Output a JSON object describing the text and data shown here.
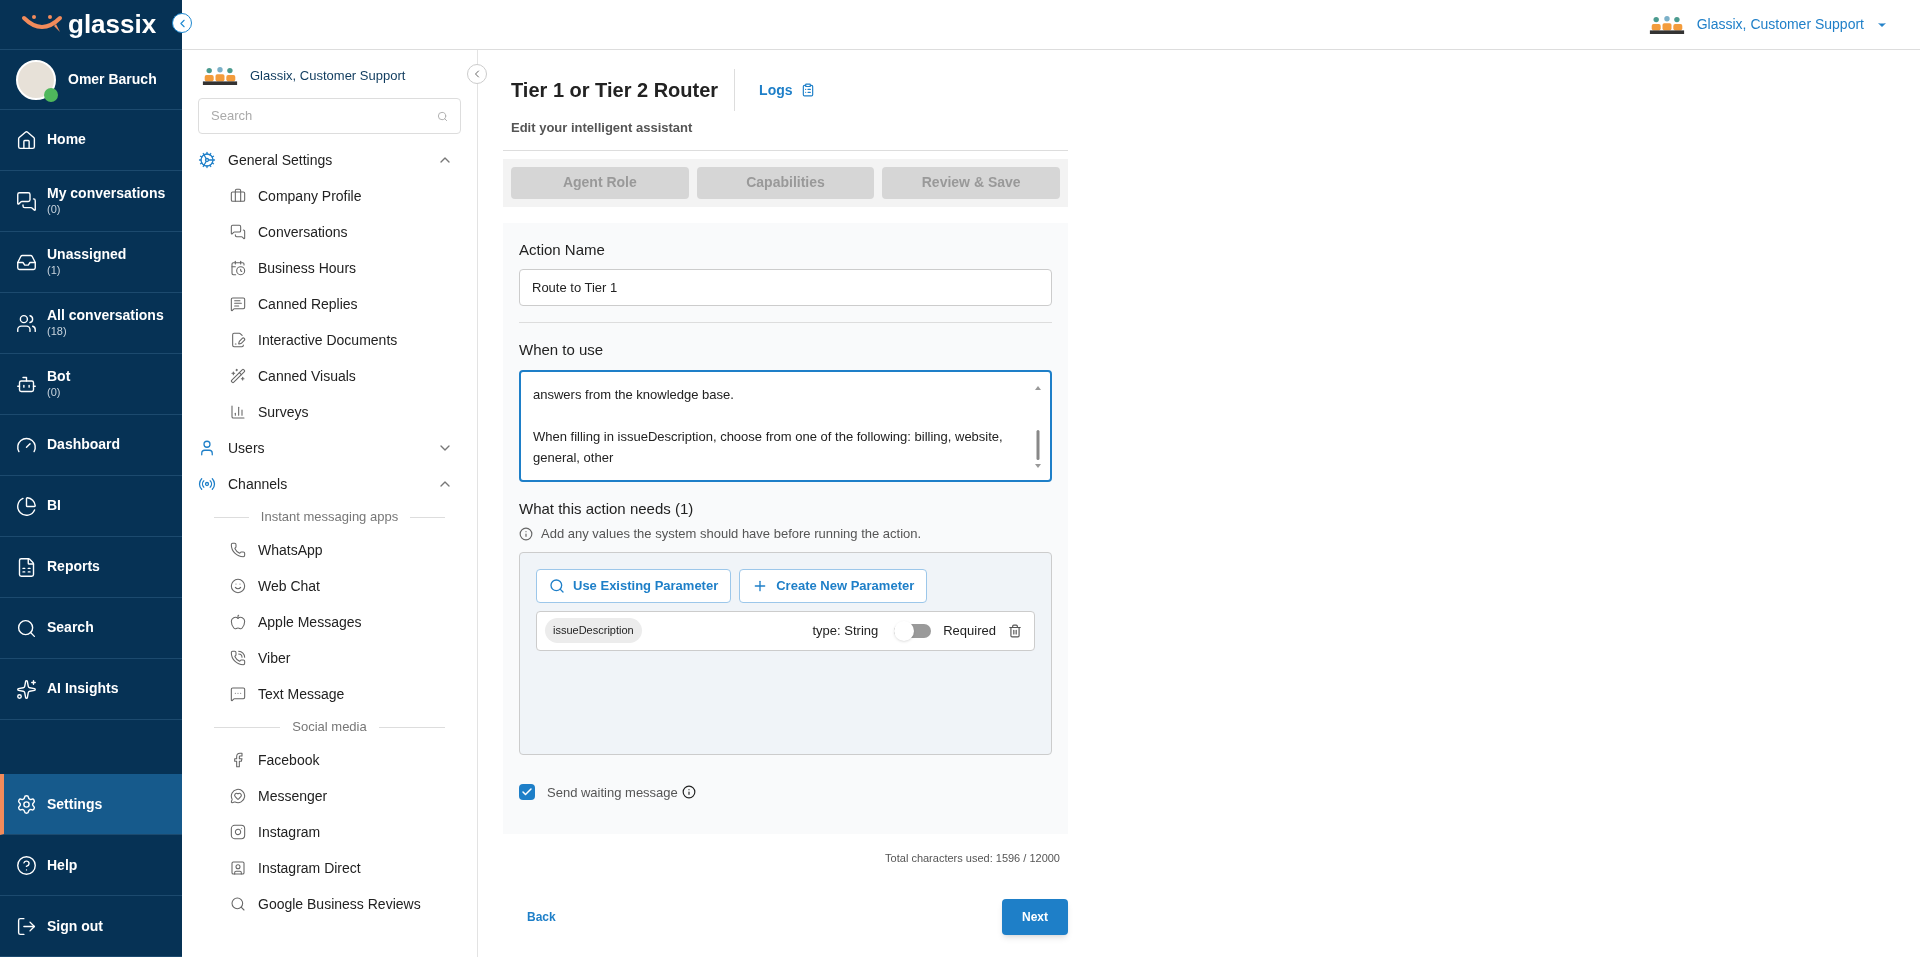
{
  "brand": {
    "name": "glassix"
  },
  "account": {
    "name": "Glassix, Customer Support"
  },
  "user": {
    "name": "Omer Baruch",
    "online": true
  },
  "nav": [
    {
      "label": "Home",
      "selected": false
    },
    {
      "label": "My conversations",
      "count": "(0)",
      "selected": false
    },
    {
      "label": "Unassigned",
      "count": "(1)",
      "selected": false
    },
    {
      "label": "All conversations",
      "count": "(18)",
      "selected": false
    },
    {
      "label": "Bot",
      "count": "(0)",
      "selected": false
    },
    {
      "label": "Dashboard",
      "selected": false
    },
    {
      "label": "BI",
      "selected": false
    },
    {
      "label": "Reports",
      "selected": false
    },
    {
      "label": "Search",
      "selected": false
    },
    {
      "label": "AI Insights",
      "selected": false
    }
  ],
  "nav_bottom": [
    {
      "label": "Settings",
      "selected": true
    },
    {
      "label": "Help",
      "selected": false
    },
    {
      "label": "Sign out",
      "selected": false
    }
  ],
  "settings_sidebar": {
    "account": "Glassix, Customer Support",
    "search_placeholder": "Search",
    "groups": [
      {
        "label": "General Settings",
        "expanded": true,
        "sections": [
          {
            "items": [
              "Company Profile",
              "Conversations",
              "Business Hours",
              "Canned Replies",
              "Interactive Documents",
              "Canned Visuals",
              "Surveys"
            ]
          }
        ]
      },
      {
        "label": "Users",
        "expanded": false
      },
      {
        "label": "Channels",
        "expanded": true,
        "sections": [
          {
            "heading": "Instant messaging apps",
            "items": [
              "WhatsApp",
              "Web Chat",
              "Apple Messages",
              "Viber",
              "Text Message"
            ]
          },
          {
            "heading": "Social media",
            "items": [
              "Facebook",
              "Messenger",
              "Instagram",
              "Instagram Direct",
              "Google Business Reviews"
            ]
          }
        ]
      }
    ]
  },
  "header": {
    "title": "Tier 1 or Tier 2 Router",
    "logs": "Logs",
    "subtitle": "Edit your intelligent assistant"
  },
  "steps": [
    {
      "label": "Agent Role",
      "disabled": true
    },
    {
      "label": "Capabilities",
      "disabled": true
    },
    {
      "label": "Review & Save",
      "disabled": true
    }
  ],
  "form": {
    "action_name_label": "Action Name",
    "action_name": "Route to Tier 1",
    "when_label": "When to use",
    "when_paragraphs": [
      "answers from the knowledge base.",
      "When filling in issueDescription, choose from one of the following: billing, website, general, other"
    ],
    "needs_title": "What this action needs (1)",
    "needs_hint": "Add any values the system should have before running the action.",
    "use_existing": "Use Existing Parameter",
    "create_new": "Create New Parameter",
    "parameters": [
      {
        "name": "issueDescription",
        "type": "type: String",
        "required_label": "Required",
        "required": false
      }
    ],
    "waiting": {
      "label": "Send waiting message",
      "checked": true
    }
  },
  "total_chars": "Total characters used: 1596 / 12000",
  "back": "Back",
  "next": "Next"
}
